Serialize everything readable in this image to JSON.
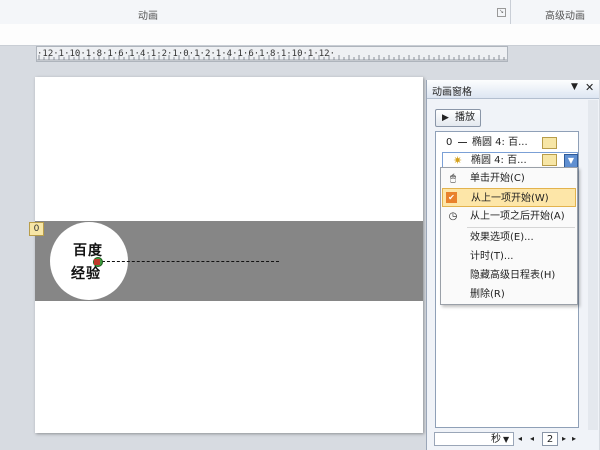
{
  "ribbon": {
    "group_animation": "动画",
    "group_advanced": "高级动画"
  },
  "ruler": {
    "text": "·12·1·10·1·8·1·6·1·4·1·2·1·0·1·2·1·4·1·6·1·8·1·10·1·12·"
  },
  "slide": {
    "circle_line1": "百度",
    "circle_line2": "经验",
    "animation_tag": "0"
  },
  "pane": {
    "title": "动画窗格",
    "play_label": "播放",
    "items": [
      {
        "number": "0",
        "label": "椭圆 4: 百..."
      },
      {
        "number": "",
        "label": "椭圆 4: 百..."
      }
    ]
  },
  "context_menu": {
    "items": [
      {
        "label": "单击开始(C)",
        "icon": "mouse-click-icon",
        "selected": false
      },
      {
        "label": "从上一项开始(W)",
        "icon": "checkmark-icon",
        "selected": true
      },
      {
        "label": "从上一项之后开始(A)",
        "icon": "clock-icon",
        "selected": false
      },
      {
        "label": "效果选项(E)...",
        "icon": "",
        "selected": false
      },
      {
        "label": "计时(T)...",
        "icon": "",
        "selected": false
      },
      {
        "label": "隐藏高级日程表(H)",
        "icon": "",
        "selected": false
      },
      {
        "label": "删除(R)",
        "icon": "",
        "selected": false
      }
    ]
  },
  "timeline": {
    "unit": "秒",
    "page_value": "2"
  },
  "colors": {
    "band": "#868686",
    "selected_menu": "#fde6a8",
    "timing_bar": "#f7e6a6",
    "accent_blue": "#5f8fd1"
  }
}
